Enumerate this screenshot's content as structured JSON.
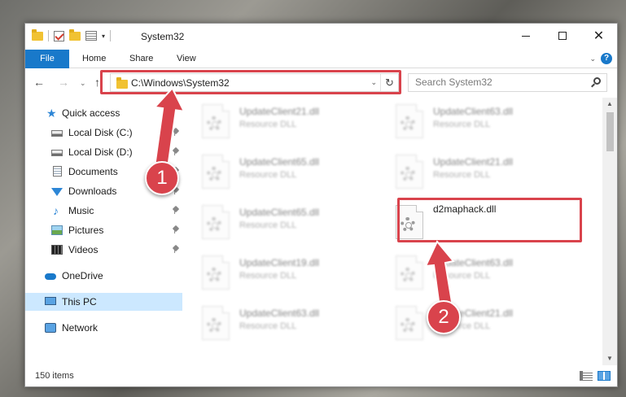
{
  "window": {
    "title": "System32",
    "controls": {
      "minimize": "—",
      "maximize": "☐",
      "close": "✕"
    }
  },
  "ribbon": {
    "tabs": [
      "File",
      "Home",
      "Share",
      "View"
    ],
    "help": "?"
  },
  "navigation": {
    "address": "C:\\Windows\\System32",
    "search_placeholder": "Search System32"
  },
  "sidebar": {
    "items": [
      {
        "label": "Quick access",
        "icon": "star-icon",
        "pinned": false
      },
      {
        "label": "Local Disk (C:)",
        "icon": "disk-icon",
        "pinned": true
      },
      {
        "label": "Local Disk (D:)",
        "icon": "disk-icon",
        "pinned": true
      },
      {
        "label": "Documents",
        "icon": "documents-icon",
        "pinned": true
      },
      {
        "label": "Downloads",
        "icon": "downloads-icon",
        "pinned": true
      },
      {
        "label": "Music",
        "icon": "music-icon",
        "pinned": true
      },
      {
        "label": "Pictures",
        "icon": "pictures-icon",
        "pinned": true
      },
      {
        "label": "Videos",
        "icon": "videos-icon",
        "pinned": true
      },
      {
        "label": "OneDrive",
        "icon": "cloud-icon",
        "pinned": false
      },
      {
        "label": "This PC",
        "icon": "computer-icon",
        "pinned": false,
        "selected": true
      },
      {
        "label": "Network",
        "icon": "network-icon",
        "pinned": false
      }
    ]
  },
  "files": [
    {
      "name": "UpdateClient21.dll",
      "type": "Resource DLL",
      "blurred": true
    },
    {
      "name": "UpdateClient63.dll",
      "type": "Resource DLL",
      "blurred": true
    },
    {
      "name": "UpdateClient65.dll",
      "type": "Resource DLL",
      "blurred": true
    },
    {
      "name": "UpdateClient21.dll",
      "type": "Resource DLL",
      "blurred": true
    },
    {
      "name": "UpdateClient65.dll",
      "type": "Resource DLL",
      "blurred": true
    },
    {
      "name": "d2maphack.dll",
      "type": "",
      "blurred": false
    },
    {
      "name": "UpdateClient19.dll",
      "type": "Resource DLL",
      "blurred": true
    },
    {
      "name": "UpdateClient63.dll",
      "type": "Resource DLL",
      "blurred": true
    },
    {
      "name": "UpdateClient63.dll",
      "type": "Resource DLL",
      "blurred": true
    },
    {
      "name": "UpdateClient21.dll",
      "type": "Resource DLL",
      "blurred": true
    }
  ],
  "status": {
    "item_count": "150 items"
  },
  "annotations": {
    "step1": "1",
    "step2": "2",
    "highlight_color": "#d9434c"
  }
}
